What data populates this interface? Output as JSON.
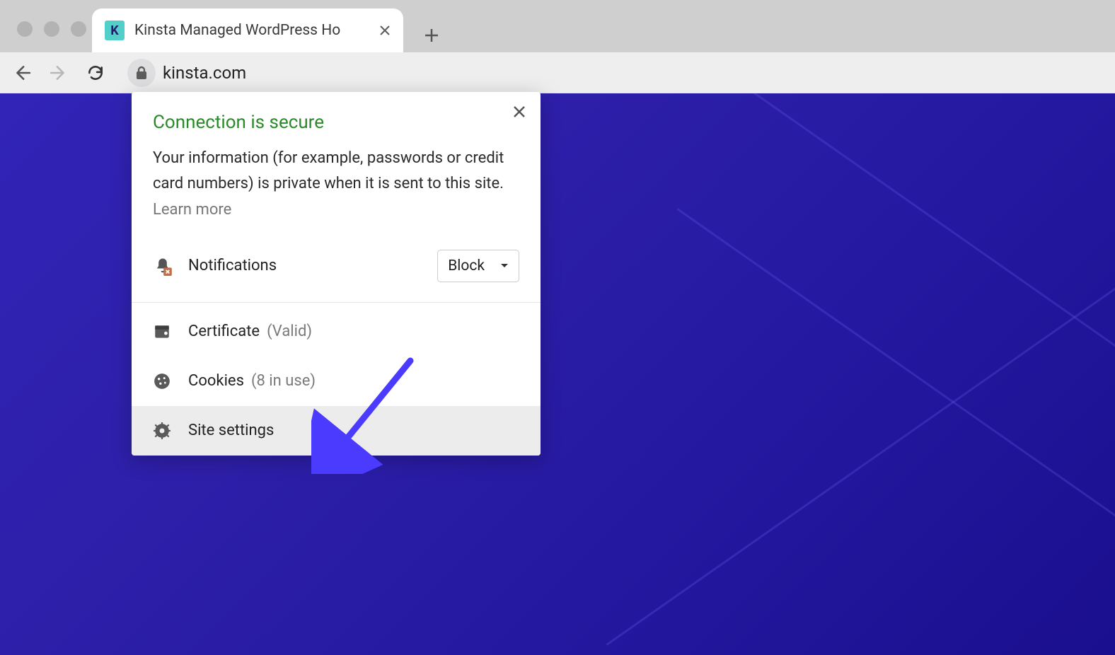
{
  "tab": {
    "title": "Kinsta Managed WordPress Ho",
    "favicon_letter": "K"
  },
  "url": "kinsta.com",
  "popover": {
    "title": "Connection is secure",
    "description": "Your information (for example, passwords or credit card numbers) is private when it is sent to this site. ",
    "learn_more": "Learn more",
    "permission_label": "Notifications",
    "permission_value": "Block",
    "certificate_label": "Certificate",
    "certificate_status": "(Valid)",
    "cookies_label": "Cookies",
    "cookies_status": "(8 in use)",
    "site_settings_label": "Site settings"
  }
}
